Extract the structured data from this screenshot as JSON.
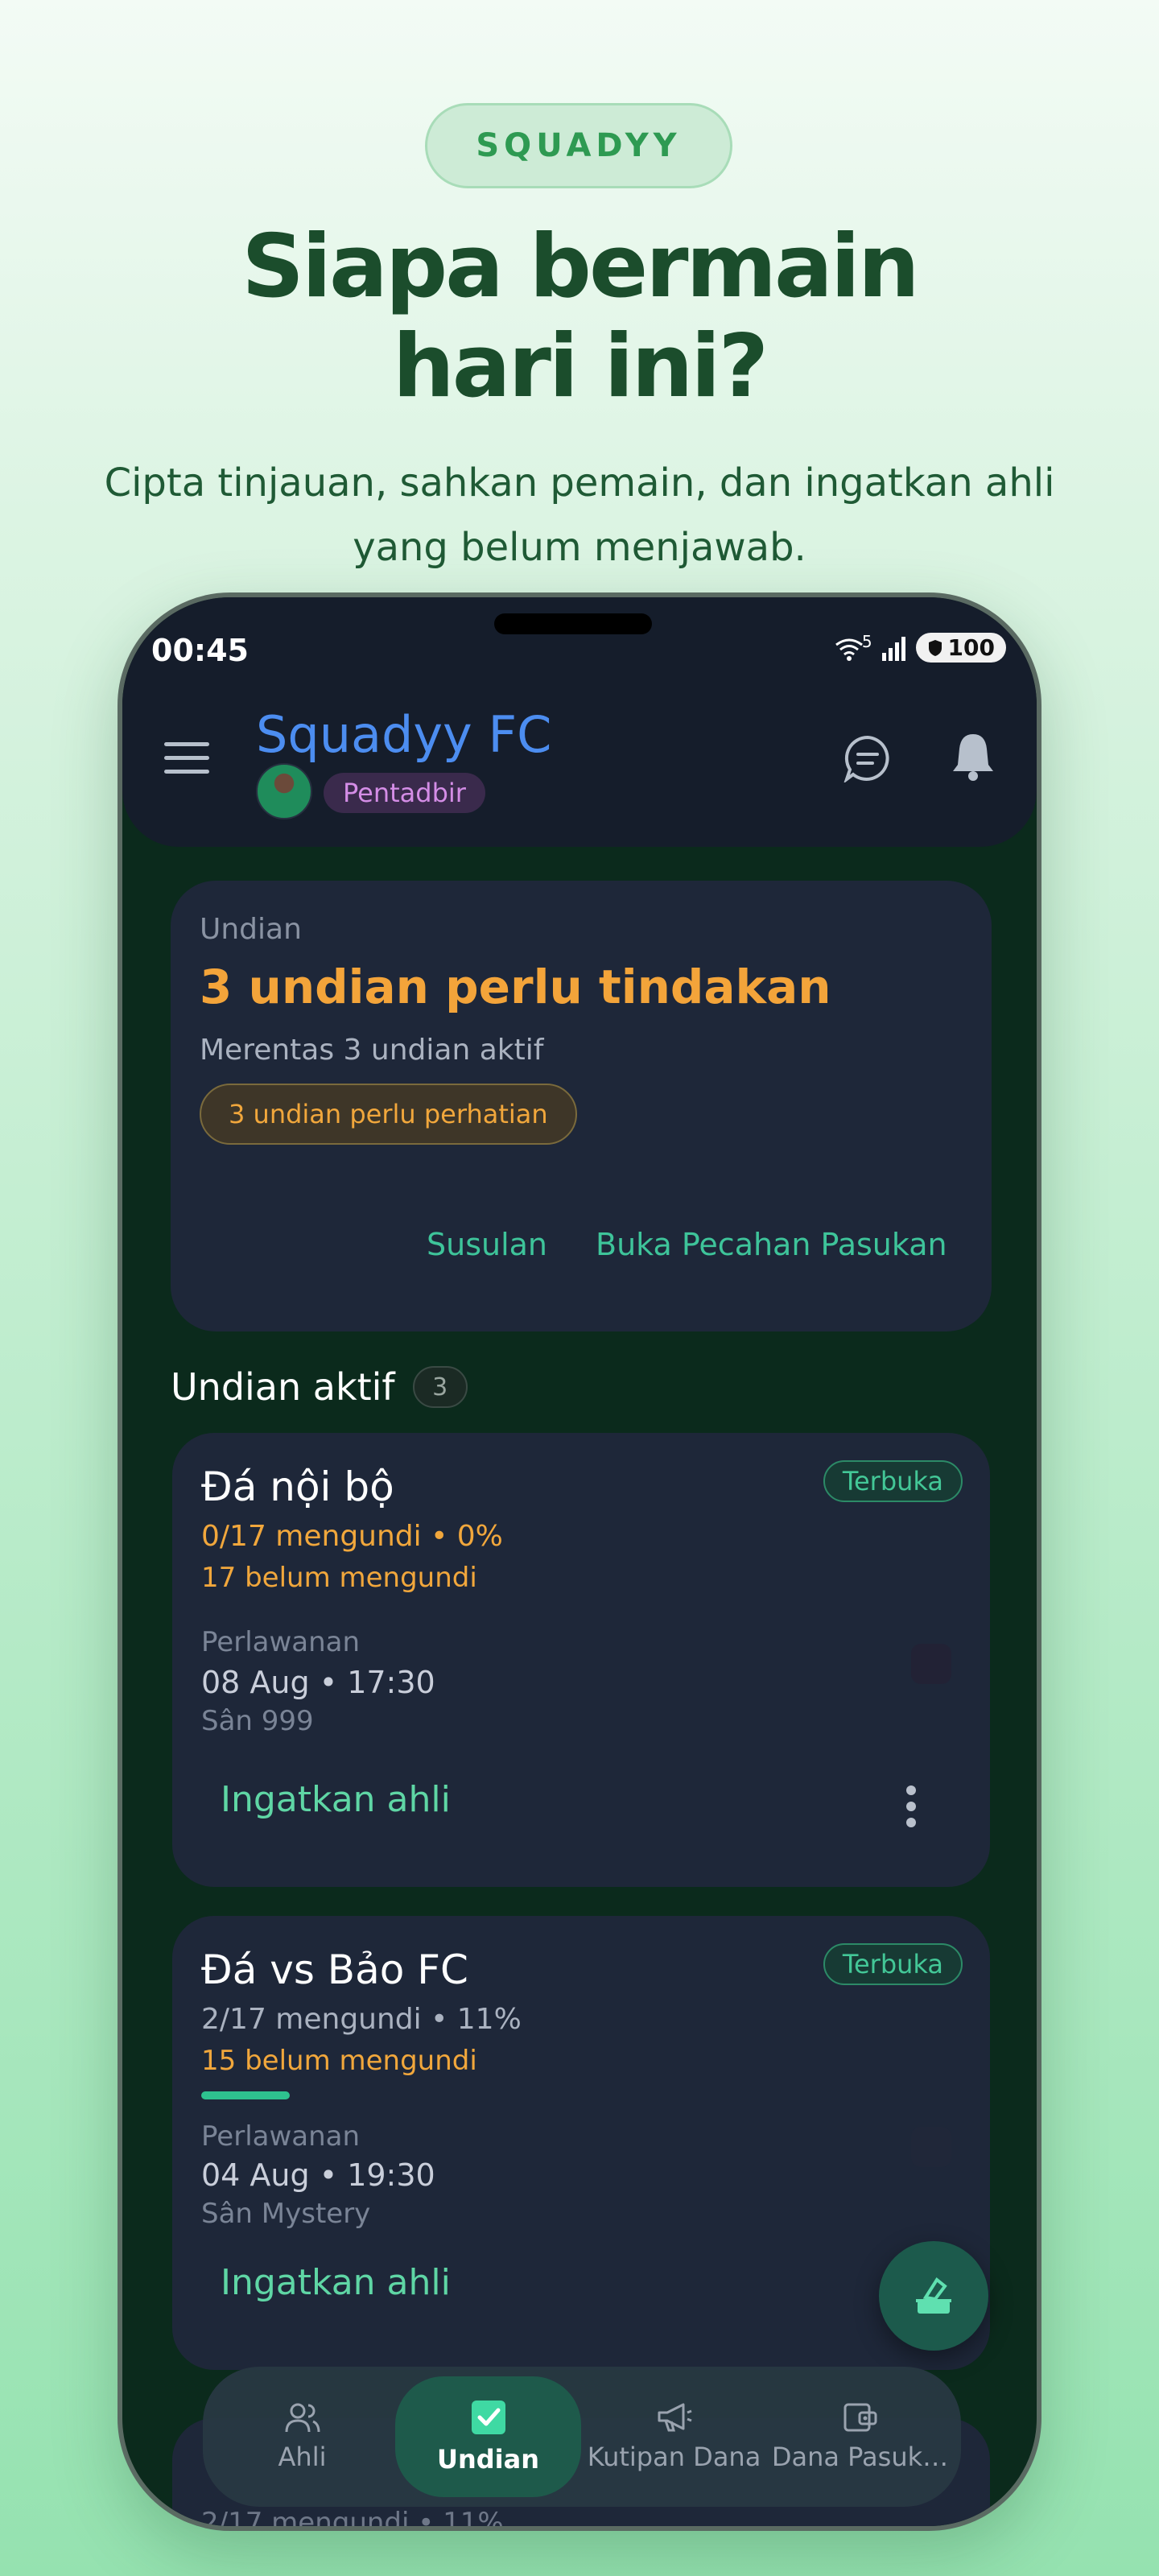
{
  "promo": {
    "badge": "SQUADYY",
    "headline_line1": "Siapa bermain",
    "headline_line2": "hari ini?",
    "subheadline": "Cipta tinjauan, sahkan pemain, dan ingatkan ahli yang belum menjawab."
  },
  "status_bar": {
    "time": "00:45",
    "battery": "100",
    "network": "5"
  },
  "app_bar": {
    "club_name": "Squadyy FC",
    "role": "Pentadbir"
  },
  "summary": {
    "label": "Undian",
    "title": "3 undian perlu tindakan",
    "subtitle": "Merentas 3 undian aktif",
    "attention": "3 undian perlu perhatian",
    "action_drafts": "Susulan",
    "action_breakdown": "Buka Pecahan Pasukan"
  },
  "active_section": {
    "title": "Undian aktif",
    "count": "3"
  },
  "polls": [
    {
      "title": "Đá nội bộ",
      "status": "Terbuka",
      "responses": "0/17 mengundi • 0%",
      "pending": "17 belum mengundi",
      "progress": 0,
      "type_label": "Perlawanan",
      "datetime": "08 Aug • 17:30",
      "venue": "Sân 999",
      "remind": "Ingatkan ahli"
    },
    {
      "title": "Đá vs Bảo FC",
      "status": "Terbuka",
      "responses": "2/17 mengundi • 11%",
      "pending": "15 belum mengundi",
      "progress": 0.11,
      "type_label": "Perlawanan",
      "datetime": "04 Aug • 19:30",
      "venue": "Sân Mystery",
      "remind": "Ingatkan ahli"
    },
    {
      "responses": "2/17 mengundi • 11%"
    }
  ],
  "bottom_nav": [
    {
      "label": "Ahli",
      "icon": "members-icon"
    },
    {
      "label": "Undian",
      "icon": "poll-check-icon"
    },
    {
      "label": "Kutipan Dana",
      "icon": "megaphone-icon"
    },
    {
      "label": "Dana Pasuk…",
      "icon": "wallet-icon"
    }
  ],
  "colors": {
    "accent": "#3ec49a",
    "warning": "#f3a43a",
    "brand_blue": "#4c8df0",
    "card": "#1e2739"
  }
}
